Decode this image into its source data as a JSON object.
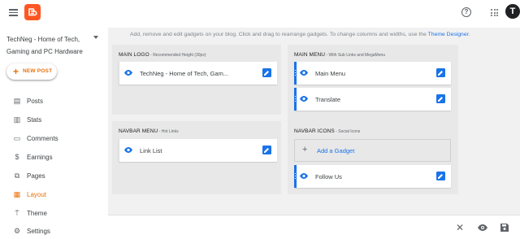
{
  "topbar": {
    "menu_icon": "hamburger-menu-icon",
    "logo_icon": "blogger-logo",
    "help_icon": "help-circle-icon",
    "apps_icon": "apps-grid-icon",
    "avatar_letter": "T"
  },
  "sidebar": {
    "blog_title": "TechNeg - Home of Tech, Gaming and PC Hardware",
    "new_post_plus": "+",
    "new_post_label": "NEW POST",
    "items": [
      {
        "label": "Posts",
        "icon": "posts-icon",
        "glyph": "▤"
      },
      {
        "label": "Stats",
        "icon": "stats-icon",
        "glyph": "▥"
      },
      {
        "label": "Comments",
        "icon": "comments-icon",
        "glyph": "▭"
      },
      {
        "label": "Earnings",
        "icon": "earnings-icon",
        "glyph": "$"
      },
      {
        "label": "Pages",
        "icon": "pages-icon",
        "glyph": "⧉"
      },
      {
        "label": "Layout",
        "icon": "layout-icon",
        "glyph": "▦",
        "active": true
      },
      {
        "label": "Theme",
        "icon": "theme-icon",
        "glyph": "⍑"
      },
      {
        "label": "Settings",
        "icon": "settings-icon",
        "glyph": "⚙"
      }
    ]
  },
  "main": {
    "intro_text": "Add, remove and edit gadgets on your blog. Click and drag to rearrange gadgets. To change columns and widths, use the ",
    "intro_link": "Theme Designer",
    "intro_end": ".",
    "sections": {
      "main_logo": {
        "title": "MAIN LOGO",
        "subtitle": " - Recommended Height (30px)",
        "gadgets": [
          "TechNeg - Home of Tech, Gam..."
        ]
      },
      "main_menu": {
        "title": "MAIN MENU",
        "subtitle": " - With Sub Links and MegaMenu",
        "gadgets": [
          "Main Menu",
          "Translate"
        ]
      },
      "navbar_menu": {
        "title": "NAVBAR MENU",
        "subtitle": " - Hot Links",
        "gadgets": [
          "Link List"
        ]
      },
      "navbar_icons": {
        "title": "NAVBAR ICONS",
        "subtitle": " - Social Icons",
        "add_gadget_plus": "+",
        "add_gadget_label": "Add a Gadget",
        "gadgets": [
          "Follow Us"
        ]
      }
    }
  },
  "bottombar": {
    "close_label": "✕",
    "close_icon": "close-icon",
    "preview_icon": "preview-eye-icon",
    "save_icon": "save-icon"
  },
  "colors": {
    "accent": "#e8710a",
    "link_blue": "#1a73e8",
    "logo_orange": "#ff5722"
  }
}
